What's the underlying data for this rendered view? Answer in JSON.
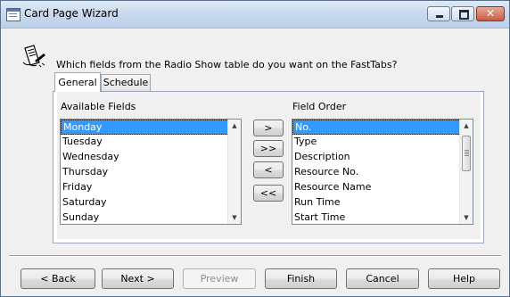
{
  "window": {
    "title": "Card Page Wizard",
    "minimize_symbol": "—",
    "maximize_symbol": "□",
    "close_symbol": "✕"
  },
  "wizard": {
    "icon": "wizard-pen-icon",
    "question": "Which fields from the Radio Show table do you want on the FastTabs?"
  },
  "tabs": [
    {
      "label": "General",
      "active": true
    },
    {
      "label": "Schedule",
      "active": false
    }
  ],
  "available": {
    "label": "Available Fields",
    "items": [
      "Monday",
      "Tuesday",
      "Wednesday",
      "Thursday",
      "Friday",
      "Saturday",
      "Sunday"
    ],
    "selected": "Monday"
  },
  "field_order": {
    "label": "Field Order",
    "items": [
      "No.",
      "Type",
      "Description",
      "Resource No.",
      "Resource Name",
      "Run Time",
      "Start Time"
    ],
    "selected": "No."
  },
  "move_buttons": {
    "add": ">",
    "add_all": ">>",
    "remove": "<",
    "remove_all": "<<"
  },
  "footer": {
    "back": "< Back",
    "next": "Next >",
    "preview": "Preview",
    "finish": "Finish",
    "cancel": "Cancel",
    "help": "Help"
  },
  "colors": {
    "selection": "#3399ff",
    "title_gradient_top": "#dfe9f5",
    "title_gradient_bottom": "#bcd0ea",
    "close_button": "#c75b45"
  }
}
